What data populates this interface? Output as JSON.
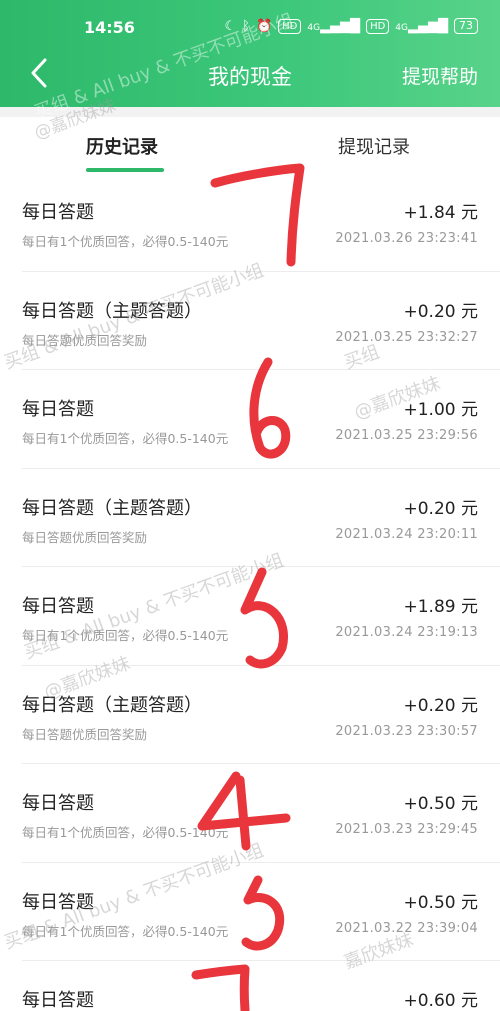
{
  "status_bar": {
    "time": "14:56",
    "icons": [
      "moon-icon",
      "bluetooth-icon",
      "alarm-icon",
      "hd-icon",
      "signal-4g-icon",
      "hd-icon",
      "signal-4g-icon",
      "battery-icon"
    ],
    "hd1": "HD",
    "net1": "4G",
    "hd2": "HD",
    "net2": "4G",
    "battery": "73"
  },
  "navbar": {
    "back_icon": "chevron-left-icon",
    "title": "我的现金",
    "help_label": "提现帮助"
  },
  "tabs": [
    {
      "label": "历史记录",
      "active": true
    },
    {
      "label": "提现记录",
      "active": false
    }
  ],
  "records": [
    {
      "title": "每日答题",
      "subtitle": "每日有1个优质回答，必得0.5-140元",
      "amount": "+1.84 元",
      "date": "2021.03.26 23:23:41"
    },
    {
      "title": "每日答题（主题答题）",
      "subtitle": "每日答题优质回答奖励",
      "amount": "+0.20 元",
      "date": "2021.03.25 23:32:27"
    },
    {
      "title": "每日答题",
      "subtitle": "每日有1个优质回答，必得0.5-140元",
      "amount": "+1.00 元",
      "date": "2021.03.25 23:29:56"
    },
    {
      "title": "每日答题（主题答题）",
      "subtitle": "每日答题优质回答奖励",
      "amount": "+0.20 元",
      "date": "2021.03.24 23:20:11"
    },
    {
      "title": "每日答题",
      "subtitle": "每日有1个优质回答，必得0.5-140元",
      "amount": "+1.89 元",
      "date": "2021.03.24 23:19:13"
    },
    {
      "title": "每日答题（主题答题）",
      "subtitle": "每日答题优质回答奖励",
      "amount": "+0.20 元",
      "date": "2021.03.23 23:30:57"
    },
    {
      "title": "每日答题",
      "subtitle": "每日有1个优质回答，必得0.5-140元",
      "amount": "+0.50 元",
      "date": "2021.03.23 23:29:45"
    },
    {
      "title": "每日答题",
      "subtitle": "每日有1个优质回答，必得0.5-140元",
      "amount": "+0.50 元",
      "date": "2021.03.22 23:39:04"
    },
    {
      "title": "每日答题",
      "subtitle": "",
      "amount": "+0.60 元",
      "date": ""
    }
  ],
  "watermark": {
    "line1": "买组 & All buy & 不买不可能小组",
    "line2": "@嘉欣妹妹",
    "line3": "买组",
    "line4": "嘉欣妹妹"
  },
  "handwritten_annotations": [
    "7",
    "6",
    "5",
    "4",
    "5",
    "7"
  ],
  "colors": {
    "header_green": "#2db86a",
    "tab_underline": "#2db86a",
    "annotation_red": "#e8363c"
  }
}
